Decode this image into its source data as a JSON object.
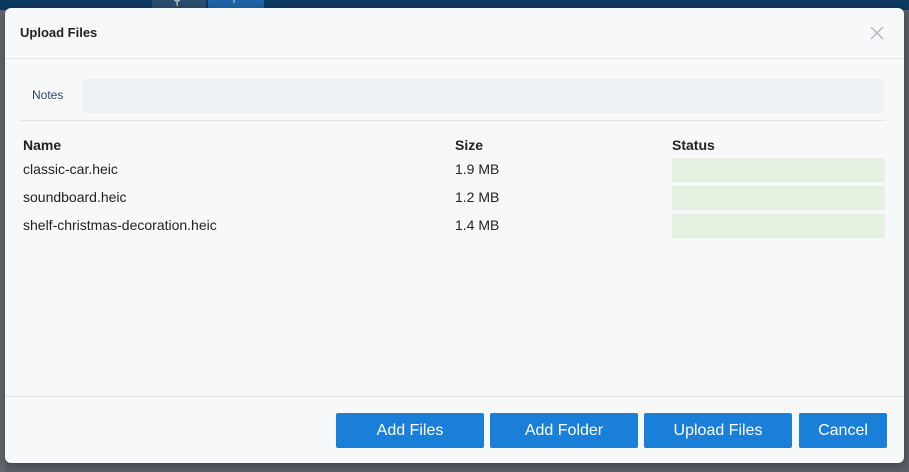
{
  "dialog": {
    "title": "Upload Files"
  },
  "notes": {
    "label": "Notes",
    "value": "",
    "placeholder": ""
  },
  "table": {
    "columns": [
      "Name",
      "Size",
      "Status"
    ],
    "rows": [
      {
        "name": "classic-car.heic",
        "size": "1.9 MB",
        "status": ""
      },
      {
        "name": "soundboard.heic",
        "size": "1.2 MB",
        "status": ""
      },
      {
        "name": "shelf-christmas-decoration.heic",
        "size": "1.4 MB",
        "status": ""
      }
    ]
  },
  "footer": {
    "add_files": "Add Files",
    "add_folder": "Add Folder",
    "upload_files": "Upload Files",
    "cancel": "Cancel"
  },
  "colors": {
    "primary_button": "#1a7fd9",
    "status_bar": "#e6f2e1",
    "notes_field": "#eff2f5",
    "topbar": "#0d3a60"
  },
  "icons": {
    "background_search": "search-icon",
    "background_add": "plus-icon",
    "close": "close-icon"
  }
}
